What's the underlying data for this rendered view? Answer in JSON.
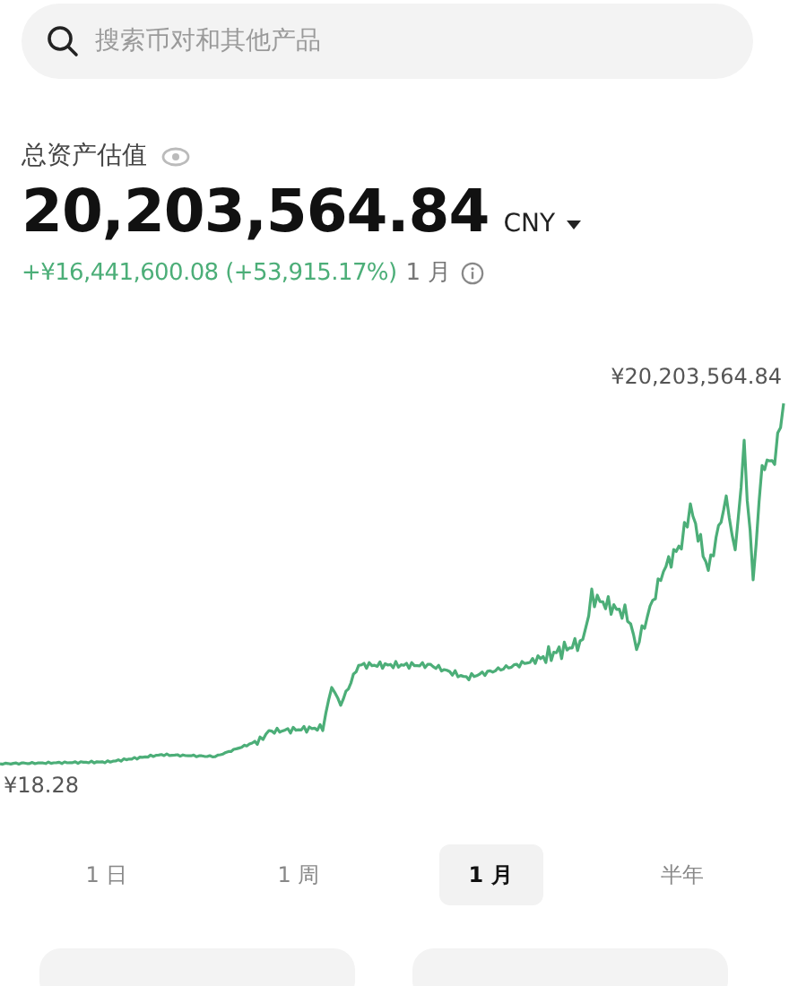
{
  "search": {
    "placeholder": "搜索币对和其他产品"
  },
  "balance": {
    "label": "总资产估值",
    "amount": "20,203,564.84",
    "currency": "CNY",
    "change": "+¥16,441,600.08 (+53,915.17%)",
    "period": "1 月"
  },
  "chart": {
    "max_label": "¥20,203,564.84",
    "min_label": "¥18.28"
  },
  "periods": [
    {
      "label": "1 日",
      "selected": false
    },
    {
      "label": "1 周",
      "selected": false
    },
    {
      "label": "1 月",
      "selected": true
    },
    {
      "label": "半年",
      "selected": false
    }
  ]
}
